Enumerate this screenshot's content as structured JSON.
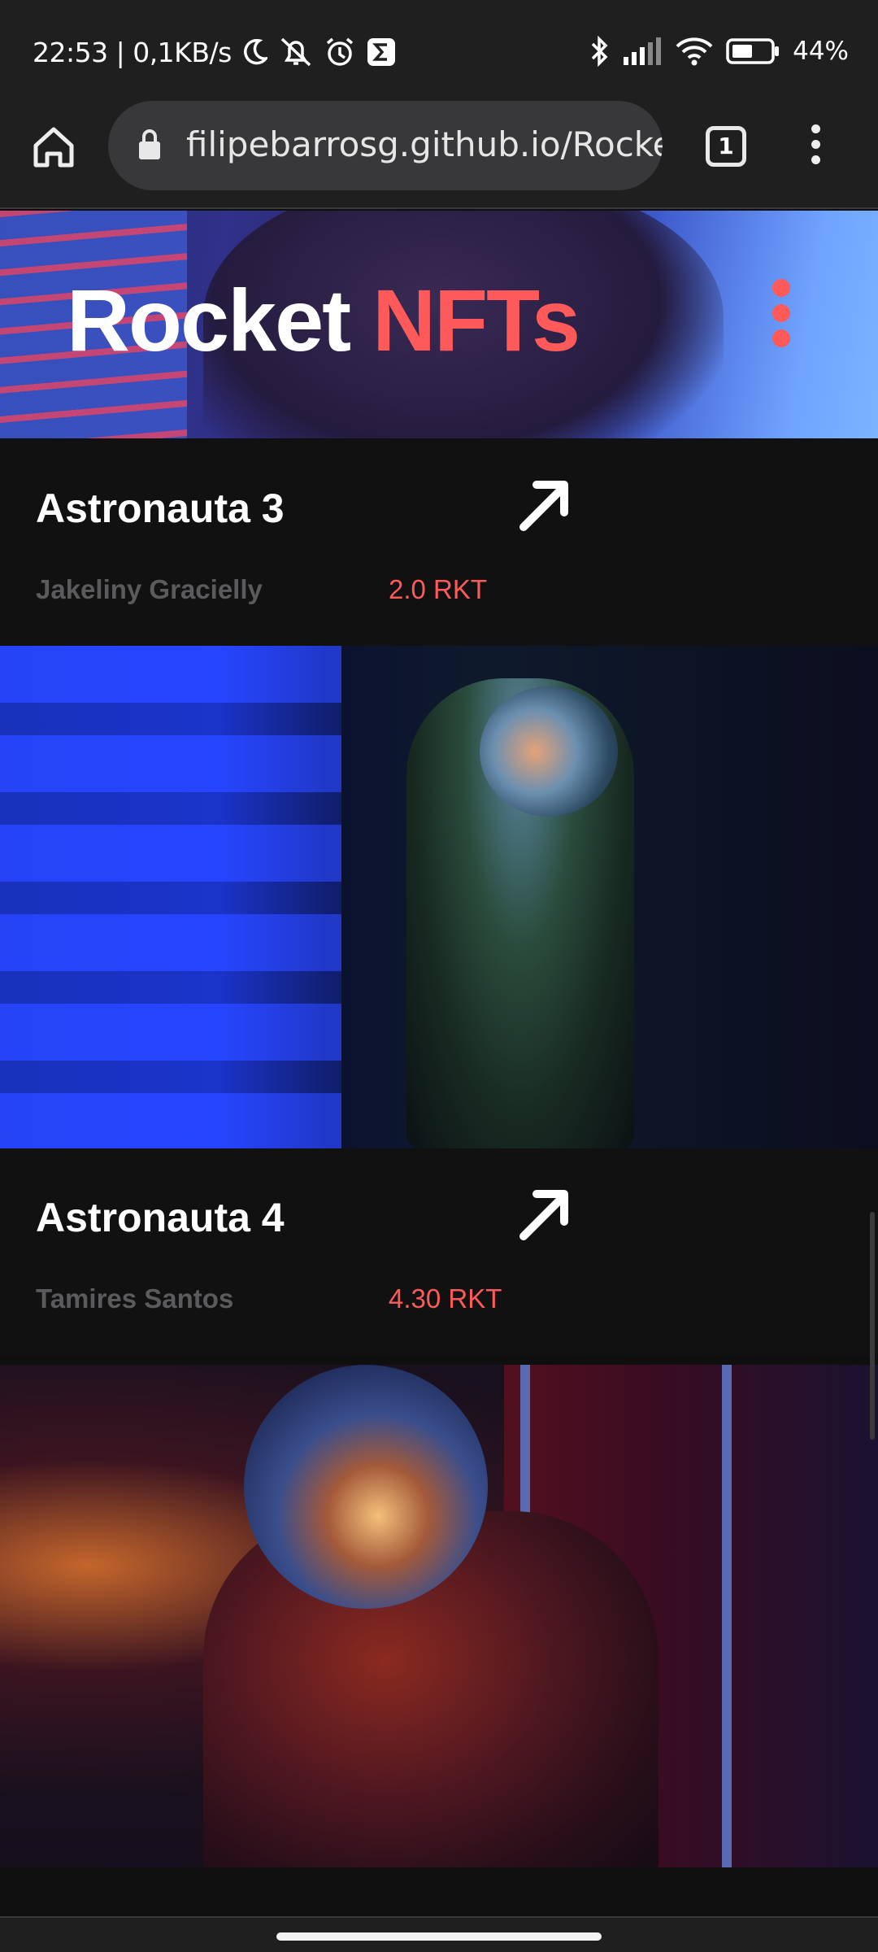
{
  "status_bar": {
    "time_net": "22:53 | 0,1KB/s",
    "battery": "44%"
  },
  "browser": {
    "url": "filipebarrosg.github.io/Rocke",
    "tab_count": "1"
  },
  "hero": {
    "title_main": "Rocket",
    "title_accent": "NFTs"
  },
  "cards": [
    {
      "title": "Astronauta 3",
      "author": "Jakeliny Gracielly",
      "price": "2.0 RKT"
    },
    {
      "title": "Astronauta 4",
      "author": "Tamires Santos",
      "price": "4.30 RKT"
    }
  ],
  "colors": {
    "accent": "#ff5a5a",
    "background": "#0f0f10",
    "muted_text": "#5b5b5e"
  }
}
